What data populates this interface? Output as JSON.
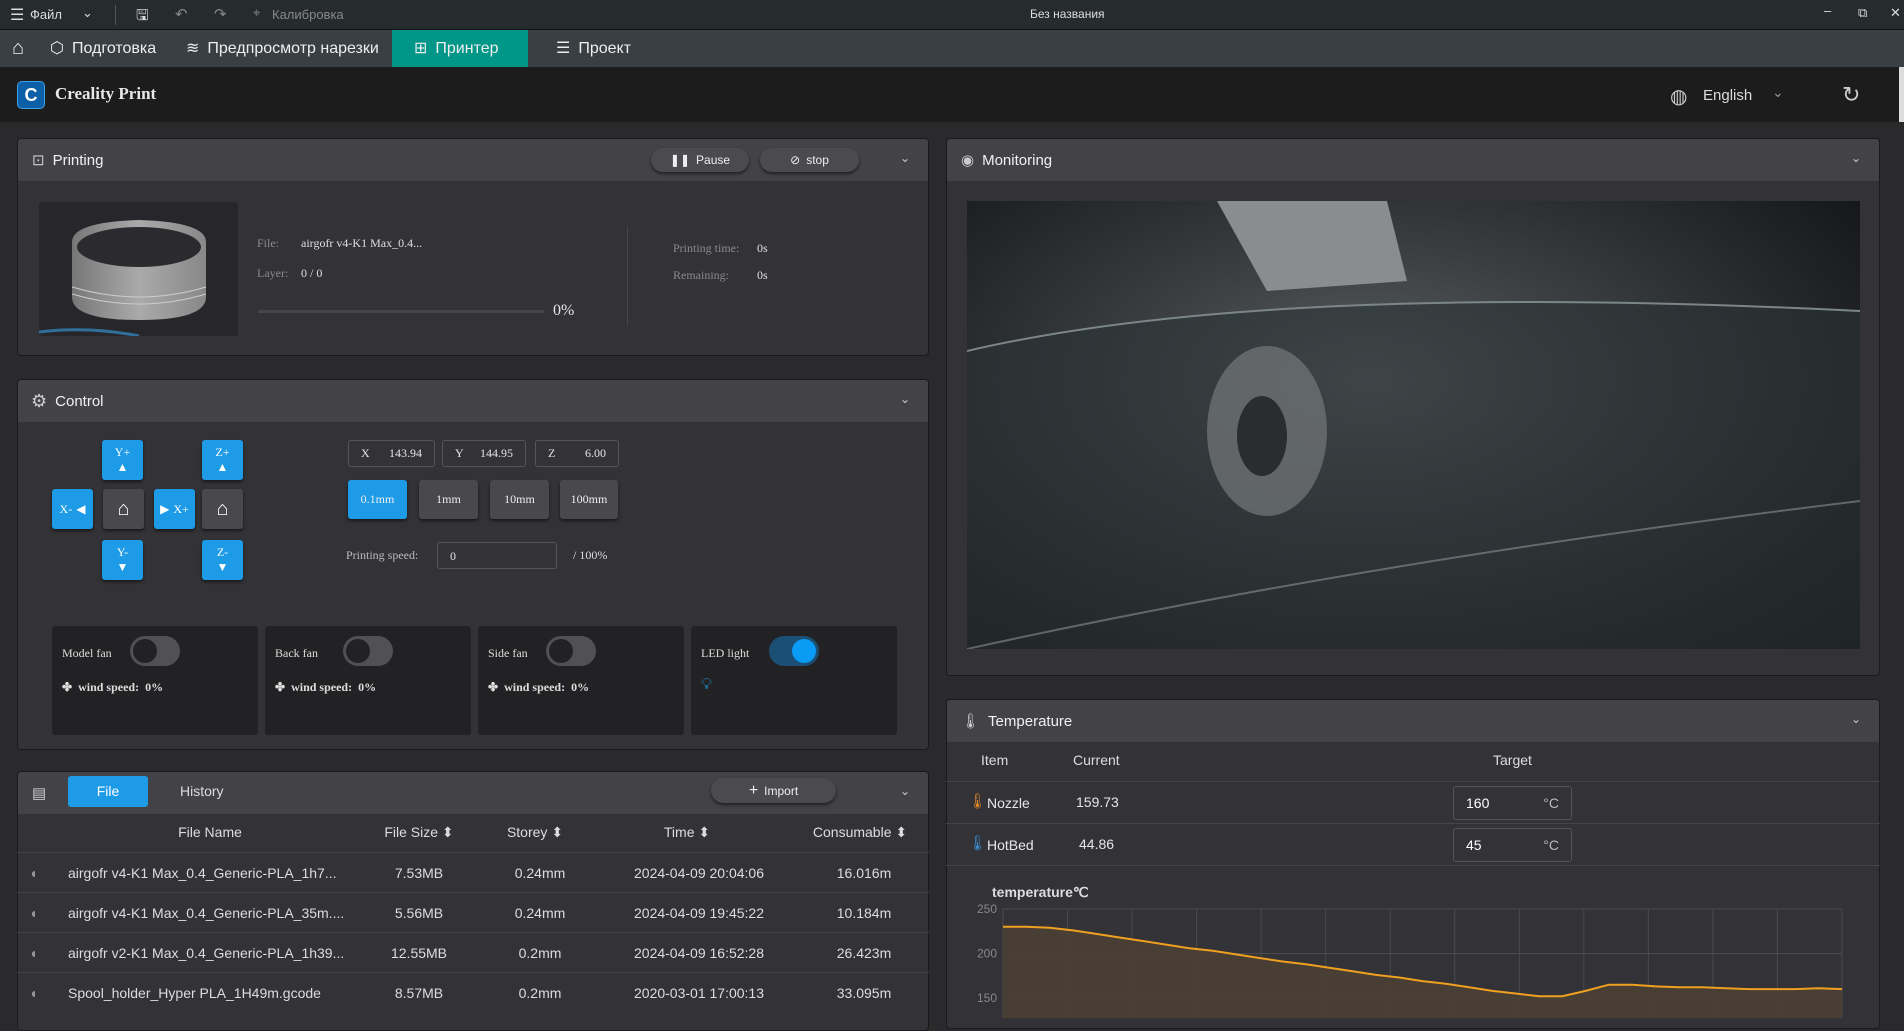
{
  "titlebar": {
    "menu_label": "Файл",
    "calibration_label": "Калибровка",
    "window_title": "Без названия"
  },
  "tabs": [
    {
      "label": "Подготовка",
      "icon": "cube-icon"
    },
    {
      "label": "Предпросмотр нарезки",
      "icon": "layers-icon"
    },
    {
      "label": "Принтер",
      "icon": "printer-icon",
      "active": true
    },
    {
      "label": "Проект",
      "icon": "list-icon"
    }
  ],
  "header": {
    "app_name": "Creality Print",
    "language": "English"
  },
  "printing": {
    "title": "Printing",
    "pause_label": "Pause",
    "stop_label": "stop",
    "file_label": "File:",
    "file_value": "airgofr v4-K1 Max_0.4...",
    "layer_label": "Layer:",
    "layer_value": "0 / 0",
    "progress_text": "0%",
    "progress": 0,
    "time_label": "Printing time:",
    "time_value": "0s",
    "remaining_label": "Remaining:",
    "remaining_value": "0s"
  },
  "control": {
    "title": "Control",
    "jog": {
      "yplus": "Y+",
      "yminus": "Y-",
      "zplus": "Z+",
      "zminus": "Z-",
      "xminus": "X-",
      "xplus": "X+"
    },
    "coords": [
      {
        "axis": "X",
        "value": "143.94"
      },
      {
        "axis": "Y",
        "value": "144.95"
      },
      {
        "axis": "Z",
        "value": "6.00"
      }
    ],
    "steps": [
      "0.1mm",
      "1mm",
      "10mm",
      "100mm"
    ],
    "active_step": "0.1mm",
    "speed_label": "Printing speed:",
    "speed_value": "0",
    "speed_suffix": "/ 100%",
    "fans": [
      {
        "name": "Model fan",
        "on": false,
        "ws_label": "wind speed:",
        "ws_value": "0%"
      },
      {
        "name": "Back fan",
        "on": false,
        "ws_label": "wind speed:",
        "ws_value": "0%"
      },
      {
        "name": "Side fan",
        "on": false,
        "ws_label": "wind speed:",
        "ws_value": "0%"
      }
    ],
    "led": {
      "name": "LED light",
      "on": true
    }
  },
  "files": {
    "tab_file": "File",
    "tab_history": "History",
    "import_label": "Import",
    "columns": [
      "File Name",
      "File Size",
      "Storey",
      "Time",
      "Consumable"
    ],
    "rows": [
      {
        "name": "airgofr v4-K1 Max_0.4_Generic-PLA_1h7...",
        "size": "7.53MB",
        "storey": "0.24mm",
        "time": "2024-04-09 20:04:06",
        "consumable": "16.016m"
      },
      {
        "name": "airgofr v4-K1 Max_0.4_Generic-PLA_35m....",
        "size": "5.56MB",
        "storey": "0.24mm",
        "time": "2024-04-09 19:45:22",
        "consumable": "10.184m"
      },
      {
        "name": "airgofr v2-K1 Max_0.4_Generic-PLA_1h39...",
        "size": "12.55MB",
        "storey": "0.2mm",
        "time": "2024-04-09 16:52:28",
        "consumable": "26.423m"
      },
      {
        "name": "Spool_holder_Hyper PLA_1H49m.gcode",
        "size": "8.57MB",
        "storey": "0.2mm",
        "time": "2020-03-01 17:00:13",
        "consumable": "33.095m"
      }
    ]
  },
  "monitoring": {
    "title": "Monitoring"
  },
  "temperature": {
    "title": "Temperature",
    "col_item": "Item",
    "col_current": "Current",
    "col_target": "Target",
    "unit": "°C",
    "rows": [
      {
        "name": "Nozzle",
        "current": "159.73",
        "target": "160",
        "color": "#e08a2a"
      },
      {
        "name": "HotBed",
        "current": "44.86",
        "target": "45",
        "color": "#3a8fd6"
      }
    ]
  },
  "chart_data": {
    "type": "area",
    "title": "temperature℃",
    "yticks": [
      250,
      200,
      150
    ],
    "ylim": [
      140,
      250
    ],
    "grid": true,
    "color": "#f0a020",
    "values": [
      230,
      230,
      229,
      226,
      222,
      218,
      214,
      210,
      206,
      203,
      199,
      195,
      191,
      188,
      184,
      180,
      176,
      173,
      169,
      166,
      162,
      158,
      155,
      152,
      152,
      158,
      165,
      165,
      163,
      162,
      162,
      161,
      160,
      160,
      160,
      161,
      160
    ]
  }
}
